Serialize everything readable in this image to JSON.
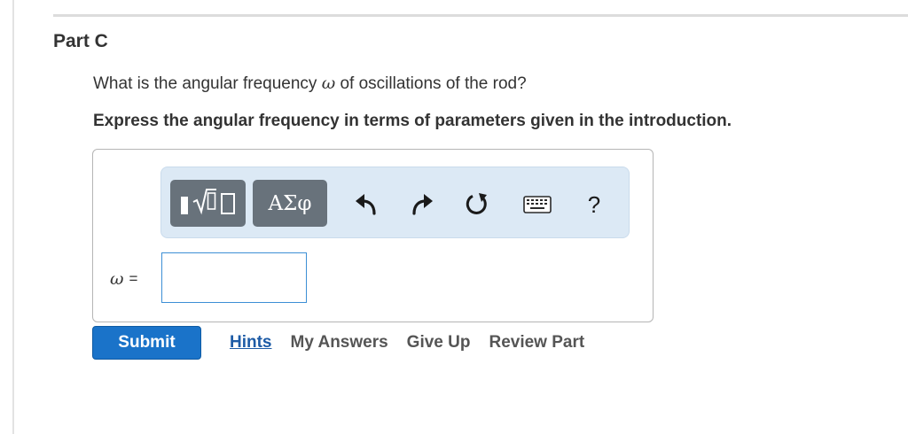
{
  "part": {
    "title": "Part C"
  },
  "question": {
    "text_before": "What is the angular frequency ",
    "symbol": "ω",
    "text_after": " of oscillations of the rod?",
    "instruction": "Express the angular frequency in terms of parameters given in the introduction."
  },
  "toolbar": {
    "templates_icon": "templates-radical-icon",
    "symbols_label": "ΑΣφ",
    "undo_icon": "undo-icon",
    "redo_icon": "redo-icon",
    "reset_icon": "reset-icon",
    "keyboard_icon": "keyboard-icon",
    "help_label": "?"
  },
  "answer": {
    "variable": "ω",
    "equals": "=",
    "value": "",
    "placeholder": ""
  },
  "actions": {
    "submit_label": "Submit",
    "hints_label": "Hints",
    "my_answers_label": "My Answers",
    "give_up_label": "Give Up",
    "review_part_label": "Review Part"
  },
  "colors": {
    "submit_bg": "#1a73c9",
    "toolbar_bg": "#dce9f5",
    "hints_link": "#1d5ba6",
    "input_border": "#3d8fd5"
  }
}
